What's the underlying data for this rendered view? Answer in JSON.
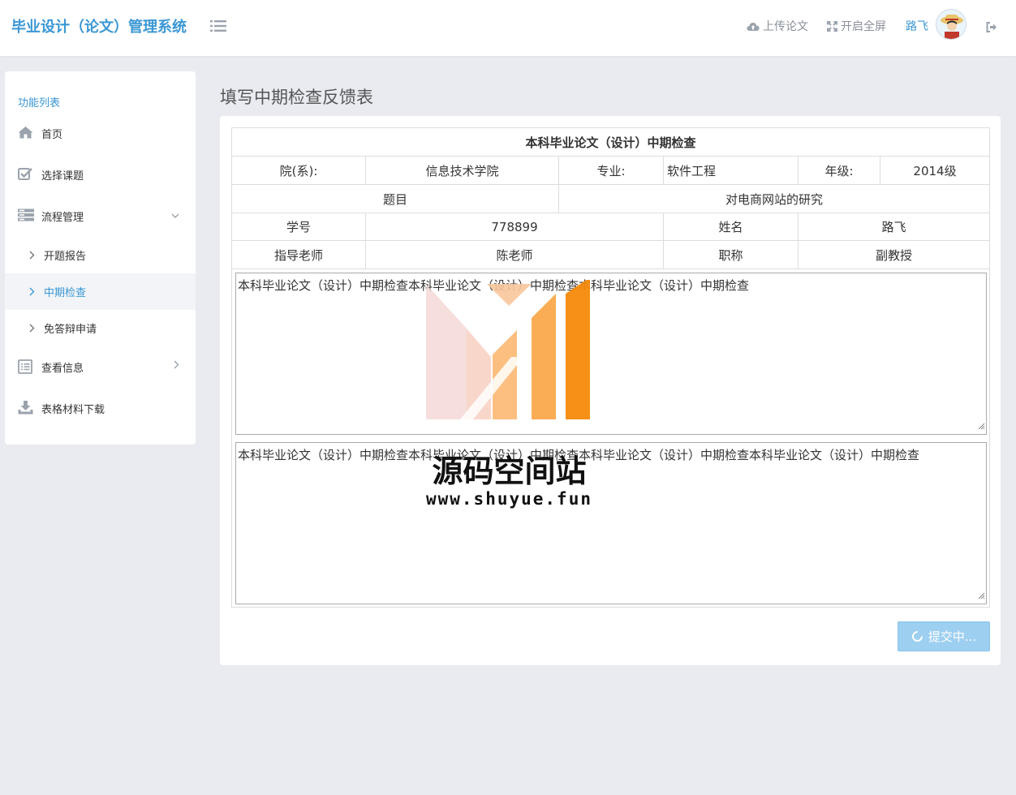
{
  "header": {
    "app_title": "毕业设计（论文）管理系统",
    "upload_label": "上传论文",
    "fullscreen_label": "开启全屏",
    "username": "路飞"
  },
  "sidebar": {
    "title": "功能列表",
    "items": [
      {
        "label": "首页"
      },
      {
        "label": "选择课题"
      },
      {
        "label": "流程管理"
      },
      {
        "label": "查看信息"
      },
      {
        "label": "表格材料下载"
      }
    ],
    "subitems": [
      {
        "label": "开题报告"
      },
      {
        "label": "中期检查"
      },
      {
        "label": "免答辩申请"
      }
    ]
  },
  "main": {
    "page_title": "填写中期检查反馈表",
    "form": {
      "title": "本科毕业论文（设计）中期检查",
      "dept_label": "院(系):",
      "dept_value": "信息技术学院",
      "major_label": "专业:",
      "major_value": "软件工程",
      "grade_label": "年级:",
      "grade_value": "2014级",
      "topic_label": "题目",
      "topic_value": "对电商网站的研究",
      "student_id_label": "学号",
      "student_id_value": "778899",
      "name_label": "姓名",
      "name_value": "路飞",
      "advisor_label": "指导老师",
      "advisor_value": "陈老师",
      "rank_label": "职称",
      "rank_value": "副教授",
      "text1": "本科毕业论文（设计）中期检查本科毕业论文（设计）中期检查本科毕业论文（设计）中期检查",
      "text2": "本科毕业论文（设计）中期检查本科毕业论文（设计）中期检查本科毕业论文（设计）中期检查本科毕业论文（设计）中期检查"
    },
    "submit_label": "提交中..."
  },
  "watermark": {
    "title": "源码空间站",
    "url": "www.shuyue.fun"
  },
  "colors": {
    "brand": "#3a97d4",
    "background": "#e9ebf1",
    "submit": "#9dcff1"
  }
}
